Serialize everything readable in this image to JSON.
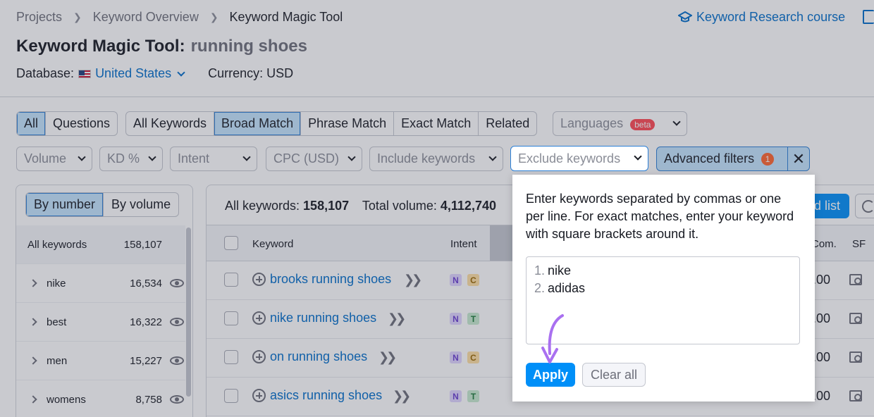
{
  "breadcrumb": [
    "Projects",
    "Keyword Overview",
    "Keyword Magic Tool"
  ],
  "course_link": "Keyword Research course",
  "title": {
    "label": "Keyword Magic Tool:",
    "query": "running shoes"
  },
  "database": {
    "label": "Database:",
    "value": "United States"
  },
  "currency": "Currency: USD",
  "tabs_type": [
    "All",
    "Questions"
  ],
  "tabs_match": [
    "All Keywords",
    "Broad Match",
    "Phrase Match",
    "Exact Match",
    "Related"
  ],
  "languages": {
    "label": "Languages",
    "badge": "beta"
  },
  "filters": [
    "Volume",
    "KD %",
    "Intent",
    "CPC (USD)",
    "Include keywords"
  ],
  "exclude": {
    "placeholder": "Exclude keywords"
  },
  "advanced": {
    "label": "Advanced filters",
    "count": "1"
  },
  "left_panel": {
    "tabs": [
      "By number",
      "By volume"
    ],
    "header": {
      "label": "All keywords",
      "count": "158,107"
    },
    "groups": [
      {
        "label": "nike",
        "count": "16,534"
      },
      {
        "label": "best",
        "count": "16,322"
      },
      {
        "label": "men",
        "count": "15,227"
      },
      {
        "label": "womens",
        "count": "8,758"
      }
    ]
  },
  "stats": {
    "all_label": "All keywords:",
    "all_value": "158,107",
    "vol_label": "Total volume:",
    "vol_value": "4,112,740"
  },
  "add_list": "d list",
  "table": {
    "headers": {
      "keyword": "Keyword",
      "intent": "Intent",
      "com": "Com.",
      "sf": "SF"
    },
    "rows": [
      {
        "keyword": "brooks running shoes",
        "intent": [
          "N",
          "C"
        ],
        "com": ".00"
      },
      {
        "keyword": "nike running shoes",
        "intent": [
          "N",
          "T"
        ],
        "com": ".00"
      },
      {
        "keyword": "on running shoes",
        "intent": [
          "N",
          "C"
        ],
        "com": ".00"
      },
      {
        "keyword": "asics running shoes",
        "intent": [
          "N",
          "T"
        ],
        "com": ".00"
      }
    ]
  },
  "popup": {
    "description": "Enter keywords separated by commas or one per line. For exact matches, enter your keyword with square brackets around it.",
    "lines": [
      {
        "n": "1.",
        "text": "nike"
      },
      {
        "n": "2.",
        "text": "adidas"
      }
    ],
    "apply": "Apply",
    "clear": "Clear all"
  }
}
